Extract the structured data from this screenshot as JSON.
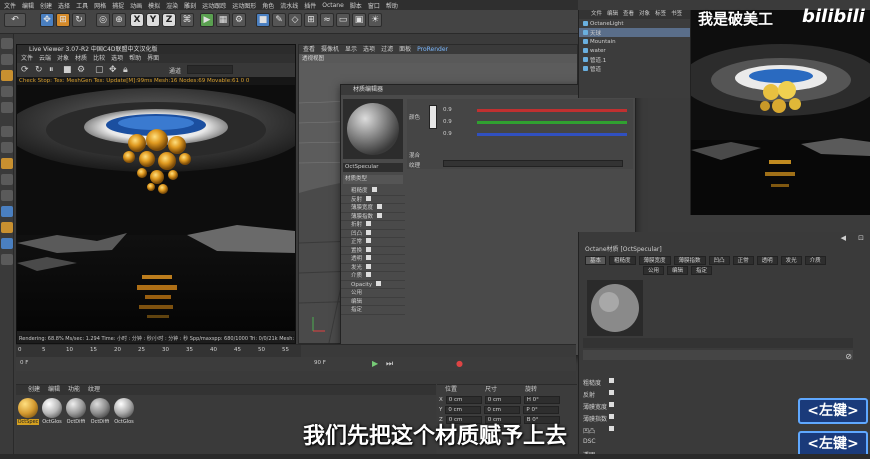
{
  "app": {
    "menu": [
      "文件",
      "编辑",
      "创建",
      "选择",
      "工具",
      "网格",
      "捕捉",
      "动画",
      "模拟",
      "渲染",
      "雕刻",
      "运动跟踪",
      "运动图形",
      "角色",
      "流水线",
      "插件",
      "Octane",
      "脚本",
      "窗口",
      "帮助"
    ]
  },
  "toolbar": {
    "xyz": [
      "X",
      "Y",
      "Z"
    ]
  },
  "live_viewer": {
    "title": "Live Viewer 3.07-R2 中国C4D联盟中文汉化版",
    "menu": [
      "文件",
      "云端",
      "对象",
      "材质",
      "比较",
      "选项",
      "帮助",
      "界面"
    ],
    "channel_select": "通道",
    "rendering_label": "[RENDERING]",
    "status": "Check Stop: Tex: MeshGen Tex: Update[M]:99ms  Mesh:16 Nodes:69  Movable:61  0 0",
    "footer": "Rendering: 68.8%   Ms/sec: 1.294   Time: 小时 : 分钟 : 秒/小时 : 分钟 : 秒   Spp/maxspp: 680/1000   Tri: 0/0/21k   Mesh: 42   Hai"
  },
  "viewport": {
    "tabs": [
      "查看",
      "摄像机",
      "显示",
      "选项",
      "过滤",
      "面板",
      "ProRender"
    ],
    "view_label": "透视视图"
  },
  "material_editor": {
    "title": "材质编辑器",
    "material_name": "OctSpecular",
    "dropdown": "材质类型",
    "channels": [
      "粗糙度",
      "反射",
      "薄膜宽度",
      "薄膜指数",
      "折射",
      "凹凸",
      "正常",
      "置换",
      "透明",
      "发光",
      "介质",
      "Opacity",
      "公用",
      "编辑",
      "指定"
    ],
    "color_label": "颜色",
    "rgb_values": [
      "0.9",
      "0.9",
      "0.9"
    ],
    "mix_label": "混合",
    "texture_label": "纹理"
  },
  "timeline": {
    "ticks": [
      "0",
      "5",
      "10",
      "15",
      "20",
      "25",
      "30",
      "35",
      "40",
      "45",
      "50",
      "55"
    ],
    "start_frame": "0 F",
    "end_frame": "90 F"
  },
  "material_manager": {
    "menu": [
      "创建",
      "编辑",
      "功能",
      "纹理"
    ],
    "materials": [
      {
        "label": "OctSpec",
        "color": "#d49a30",
        "selected": true
      },
      {
        "label": "OctGlos",
        "color": "#b8b8b8",
        "selected": false
      },
      {
        "label": "OctDiffi",
        "color": "#9a9a9a",
        "selected": false
      },
      {
        "label": "OctDiffi",
        "color": "#8c8c8c",
        "selected": false
      },
      {
        "label": "OctGlos",
        "color": "#a8a8a8",
        "selected": false
      }
    ]
  },
  "coordinates": {
    "headers": [
      "位置",
      "尺寸",
      "旋转"
    ],
    "rows": [
      {
        "axis": "X",
        "pos": "0 cm",
        "size": "0 cm",
        "rot": "H 0°"
      },
      {
        "axis": "Y",
        "pos": "0 cm",
        "size": "0 cm",
        "rot": "P 0°"
      },
      {
        "axis": "Z",
        "pos": "0 cm",
        "size": "0 cm",
        "rot": "B 0°"
      }
    ]
  },
  "object_manager": {
    "menu": [
      "文件",
      "编辑",
      "查看",
      "对象",
      "标签",
      "书签"
    ],
    "items": [
      "OctaneLight",
      "天球",
      "Mountain",
      "water",
      "管道.1",
      "管道"
    ]
  },
  "attributes": {
    "title": "Octane材质 [OctSpecular]",
    "tabs": [
      "基本",
      "粗糙度",
      "薄膜宽度",
      "薄膜指数",
      "凹凸",
      "正常",
      "透明",
      "发光",
      "介质",
      "公用",
      "编辑",
      "指定"
    ],
    "fields": [
      "粗糙度",
      "反射",
      "薄膜宽度",
      "薄膜指数",
      "凹凸",
      "DSC",
      "透明"
    ]
  },
  "overlay": {
    "watermark": "我是破美工",
    "logo": "bilibili",
    "subtitle": "我们先把这个材质赋予上去",
    "key_label_1": "<左键>",
    "key_label_2": "<左键>"
  }
}
